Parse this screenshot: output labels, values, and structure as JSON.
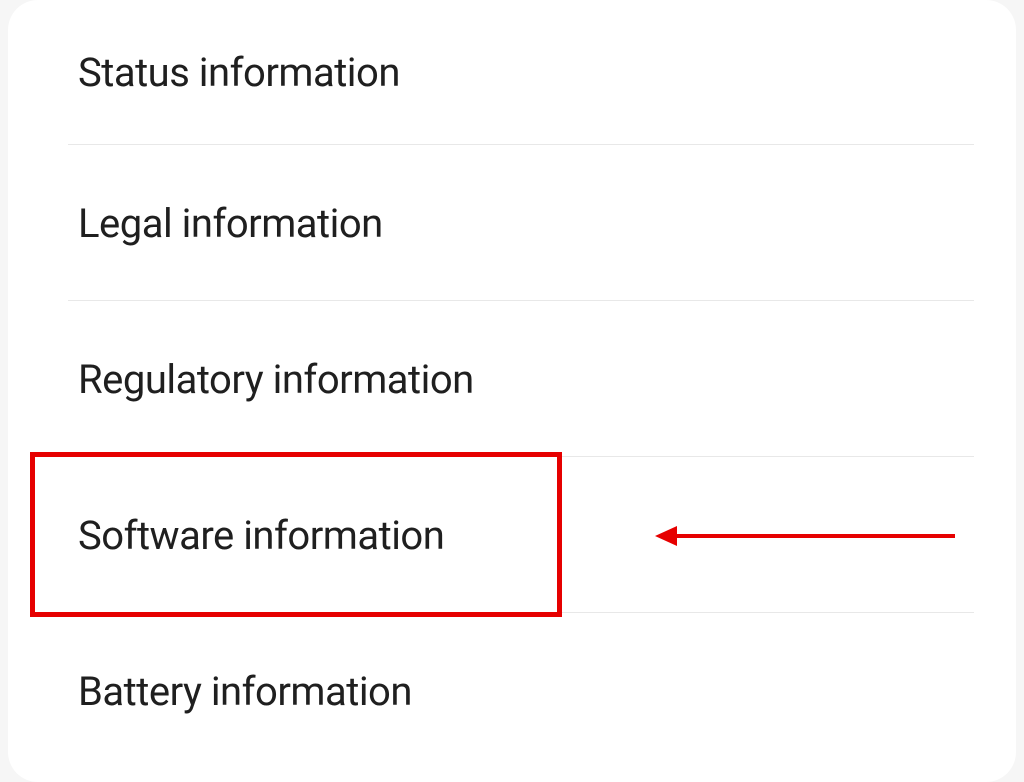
{
  "settings": {
    "items": [
      {
        "label": "Status information"
      },
      {
        "label": "Legal information"
      },
      {
        "label": "Regulatory information"
      },
      {
        "label": "Software information"
      },
      {
        "label": "Battery information"
      }
    ]
  },
  "annotation": {
    "highlighted_item": "Software information",
    "highlight_color": "#e60000"
  }
}
